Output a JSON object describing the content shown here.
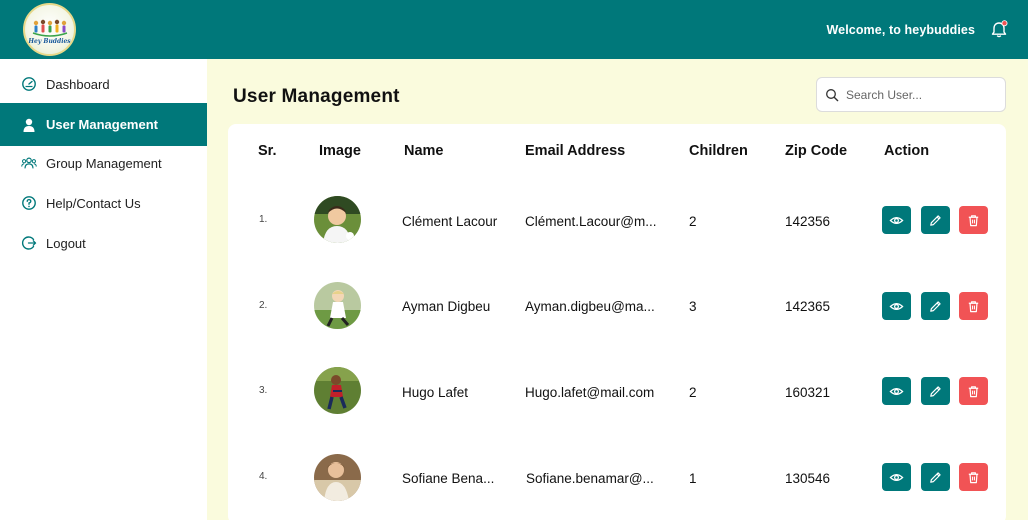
{
  "header": {
    "logo_text": "Hey Buddies",
    "welcome": "Welcome, to heybuddies"
  },
  "sidebar": {
    "items": [
      {
        "label": "Dashboard",
        "icon": "dashboard-icon",
        "active": false
      },
      {
        "label": "User Management",
        "icon": "user-icon",
        "active": true
      },
      {
        "label": "Group Management",
        "icon": "group-icon",
        "active": false
      },
      {
        "label": "Help/Contact Us",
        "icon": "help-icon",
        "active": false
      },
      {
        "label": "Logout",
        "icon": "logout-icon",
        "active": false
      }
    ]
  },
  "main": {
    "title": "User Management",
    "search_placeholder": "Search User...",
    "table": {
      "headers": [
        "Sr.",
        "Image",
        "Name",
        "Email Address",
        "Children",
        "Zip Code",
        "Action"
      ],
      "rows": [
        {
          "sr": "1.",
          "name": "Clément Lacour",
          "email": "Clément.Lacour@m...",
          "children": "2",
          "zip": "142356"
        },
        {
          "sr": "2.",
          "name": "Ayman Digbeu",
          "email": "Ayman.digbeu@ma...",
          "children": "3",
          "zip": "142365"
        },
        {
          "sr": "3.",
          "name": "Hugo Lafet",
          "email": "Hugo.lafet@mail.com",
          "children": "2",
          "zip": "160321"
        },
        {
          "sr": "4.",
          "name": "Sofiane Bena...",
          "email": "Sofiane.benamar@...",
          "children": "1",
          "zip": "130546"
        }
      ]
    }
  },
  "colors": {
    "primary": "#00787a",
    "danger": "#f15355",
    "background": "#fafbdd"
  }
}
